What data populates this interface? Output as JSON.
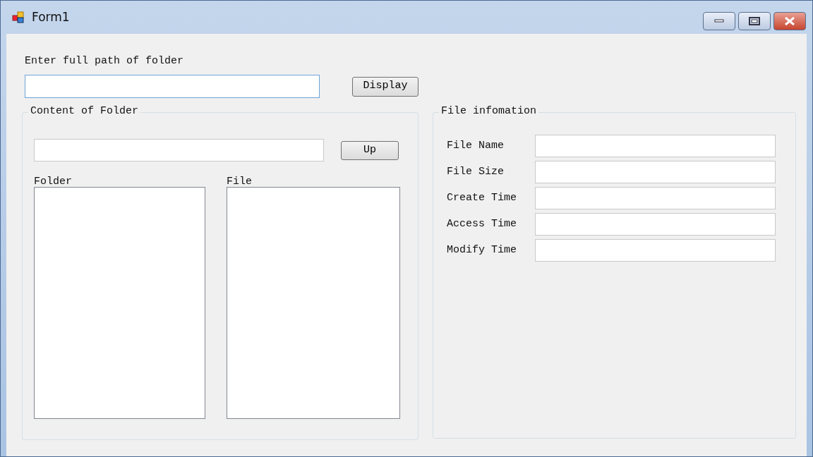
{
  "window": {
    "title": "Form1"
  },
  "path_prompt": "Enter full path of folder",
  "path_input": {
    "focused": true
  },
  "display_button": "Display",
  "folder_group": {
    "title": "Content of Folder",
    "up_button": "Up",
    "lists": [
      {
        "label": "Folder"
      },
      {
        "label": "File"
      }
    ]
  },
  "file_group": {
    "title": "File infomation",
    "fields": [
      {
        "label": "File Name"
      },
      {
        "label": "File Size"
      },
      {
        "label": "Create Time"
      },
      {
        "label": "Access Time"
      },
      {
        "label": "Modify Time"
      }
    ]
  }
}
